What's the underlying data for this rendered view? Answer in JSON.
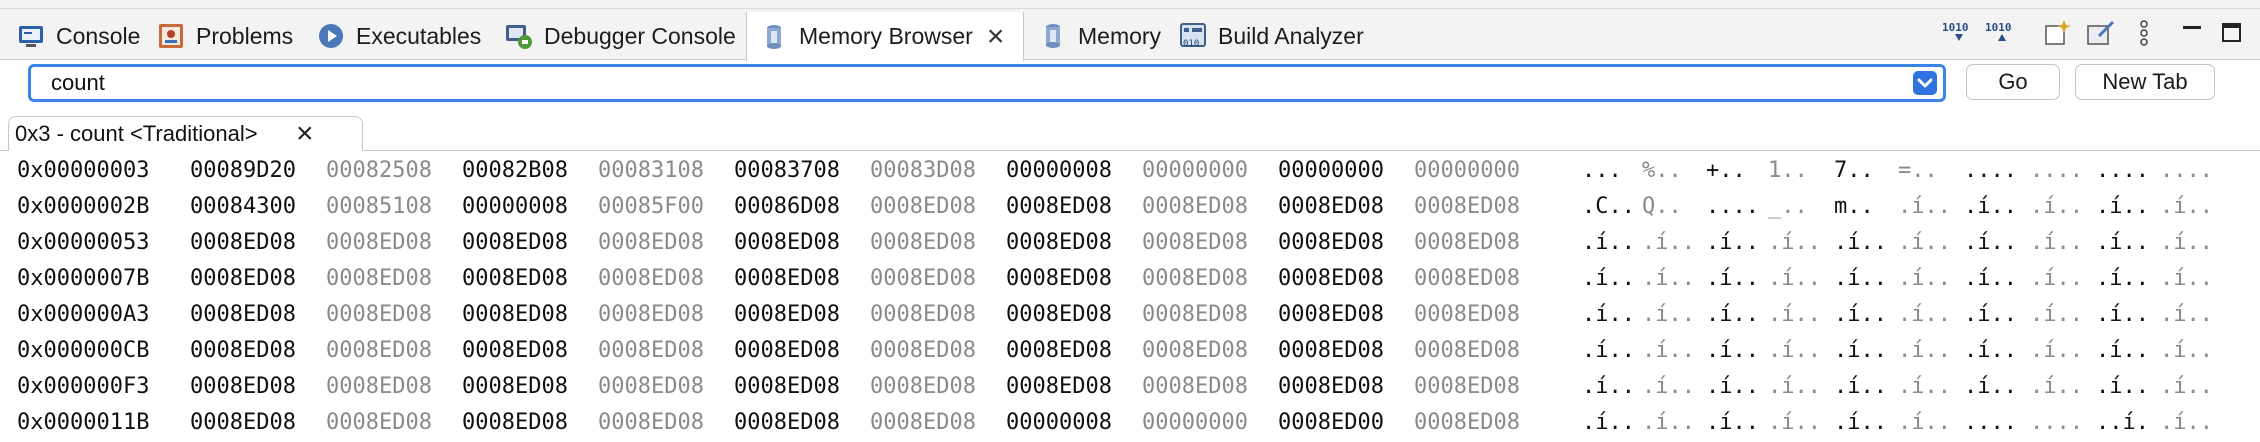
{
  "tabs": [
    {
      "label": "Console",
      "icon": "console-icon"
    },
    {
      "label": "Problems",
      "icon": "problems-icon"
    },
    {
      "label": "Executables",
      "icon": "executables-icon"
    },
    {
      "label": "Debugger Console",
      "icon": "debugger-console-icon"
    },
    {
      "label": "Memory Browser",
      "icon": "memory-browser-icon",
      "active": true
    },
    {
      "label": "Memory",
      "icon": "memory-icon"
    },
    {
      "label": "Build Analyzer",
      "icon": "build-analyzer-icon"
    }
  ],
  "address": {
    "value": "count"
  },
  "buttons": {
    "go": "Go",
    "new_tab": "New Tab"
  },
  "rendering_tab": {
    "label": "0x3 - count <Traditional>"
  },
  "memory": {
    "rows": [
      {
        "addr": "0x00000003",
        "words": [
          "00089D20",
          "00082508",
          "00082B08",
          "00083108",
          "00083708",
          "00083D08",
          "00000008",
          "00000000",
          "00000000",
          "00000000"
        ],
        "chars": [
          "...",
          "%..",
          "+..",
          "1..",
          "7..",
          "=..",
          "....",
          "....",
          "....",
          "...."
        ]
      },
      {
        "addr": "0x0000002B",
        "words": [
          "00084300",
          "00085108",
          "00000008",
          "00085F00",
          "00086D08",
          "0008ED08",
          "0008ED08",
          "0008ED08",
          "0008ED08",
          "0008ED08"
        ],
        "chars": [
          ".C..",
          "Q..",
          "....",
          "_..",
          "m..",
          ".í..",
          ".í..",
          ".í..",
          ".í..",
          ".í.."
        ]
      },
      {
        "addr": "0x00000053",
        "words": [
          "0008ED08",
          "0008ED08",
          "0008ED08",
          "0008ED08",
          "0008ED08",
          "0008ED08",
          "0008ED08",
          "0008ED08",
          "0008ED08",
          "0008ED08"
        ],
        "chars": [
          ".í..",
          ".í..",
          ".í..",
          ".í..",
          ".í..",
          ".í..",
          ".í..",
          ".í..",
          ".í..",
          ".í.."
        ]
      },
      {
        "addr": "0x0000007B",
        "words": [
          "0008ED08",
          "0008ED08",
          "0008ED08",
          "0008ED08",
          "0008ED08",
          "0008ED08",
          "0008ED08",
          "0008ED08",
          "0008ED08",
          "0008ED08"
        ],
        "chars": [
          ".í..",
          ".í..",
          ".í..",
          ".í..",
          ".í..",
          ".í..",
          ".í..",
          ".í..",
          ".í..",
          ".í.."
        ]
      },
      {
        "addr": "0x000000A3",
        "words": [
          "0008ED08",
          "0008ED08",
          "0008ED08",
          "0008ED08",
          "0008ED08",
          "0008ED08",
          "0008ED08",
          "0008ED08",
          "0008ED08",
          "0008ED08"
        ],
        "chars": [
          ".í..",
          ".í..",
          ".í..",
          ".í..",
          ".í..",
          ".í..",
          ".í..",
          ".í..",
          ".í..",
          ".í.."
        ]
      },
      {
        "addr": "0x000000CB",
        "words": [
          "0008ED08",
          "0008ED08",
          "0008ED08",
          "0008ED08",
          "0008ED08",
          "0008ED08",
          "0008ED08",
          "0008ED08",
          "0008ED08",
          "0008ED08"
        ],
        "chars": [
          ".í..",
          ".í..",
          ".í..",
          ".í..",
          ".í..",
          ".í..",
          ".í..",
          ".í..",
          ".í..",
          ".í.."
        ]
      },
      {
        "addr": "0x000000F3",
        "words": [
          "0008ED08",
          "0008ED08",
          "0008ED08",
          "0008ED08",
          "0008ED08",
          "0008ED08",
          "0008ED08",
          "0008ED08",
          "0008ED08",
          "0008ED08"
        ],
        "chars": [
          ".í..",
          ".í..",
          ".í..",
          ".í..",
          ".í..",
          ".í..",
          ".í..",
          ".í..",
          ".í..",
          ".í.."
        ]
      },
      {
        "addr": "0x0000011B",
        "words": [
          "0008ED08",
          "0008ED08",
          "0008ED08",
          "0008ED08",
          "0008ED08",
          "0008ED08",
          "00000008",
          "00000000",
          "0008ED00",
          "0008ED08"
        ],
        "chars": [
          ".í..",
          ".í..",
          ".í..",
          ".í..",
          ".í..",
          ".í..",
          "....",
          "....",
          "..í.",
          ".í.."
        ]
      }
    ]
  },
  "colors": {
    "accent": "#3a85e6",
    "dim_text": "#8a8a8a",
    "text": "#111111"
  }
}
